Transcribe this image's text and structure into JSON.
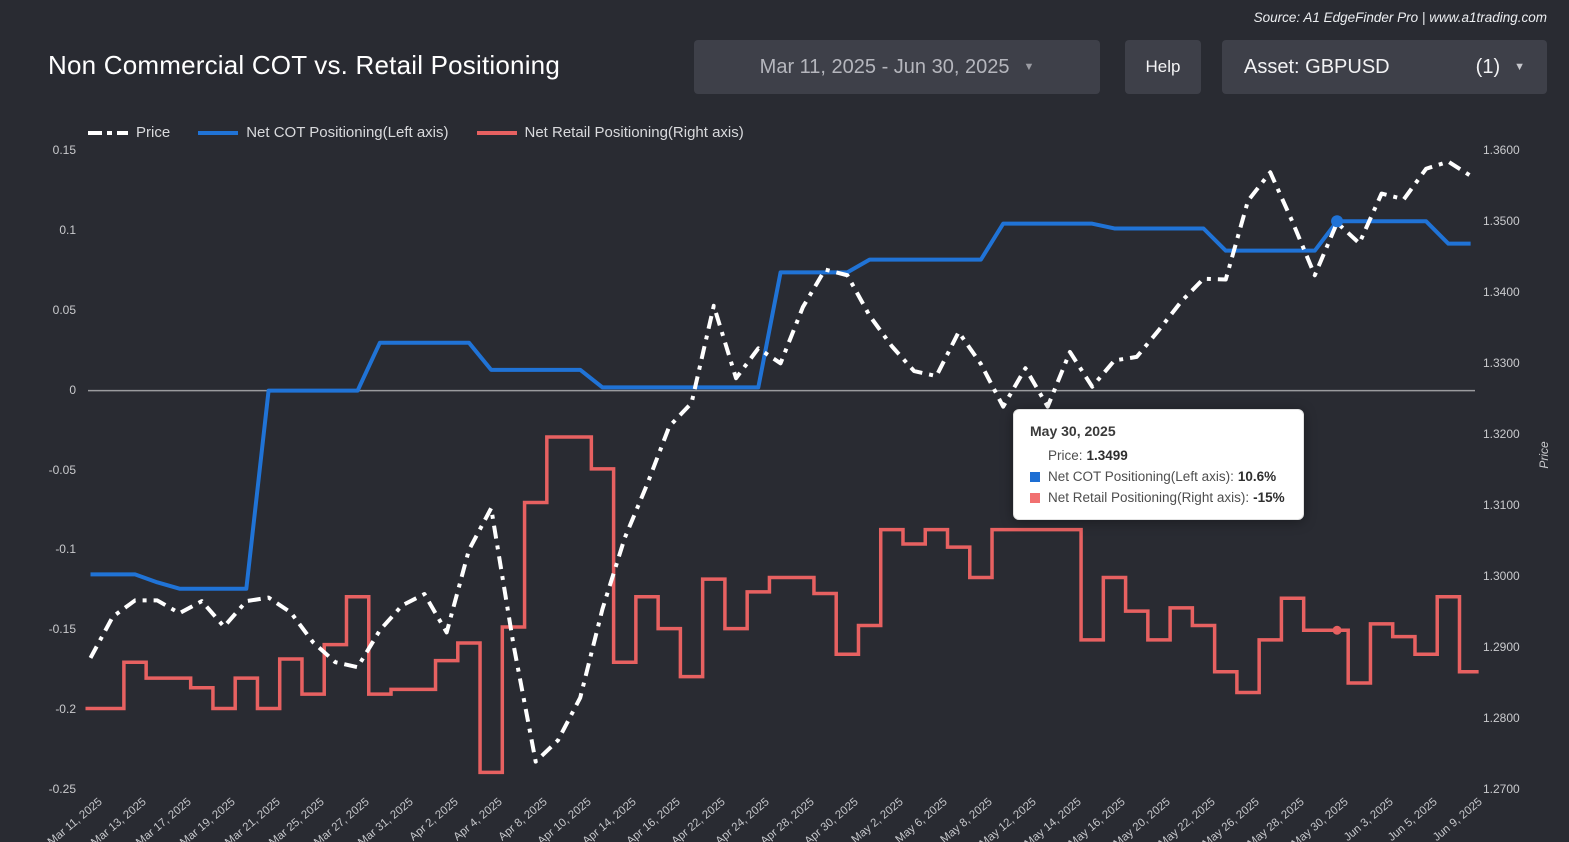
{
  "header": {
    "source_note": "Source: A1 EdgeFinder Pro | www.a1trading.com",
    "title": "Non Commercial COT vs. Retail Positioning",
    "date_range_label": "Mar 11, 2025 - Jun 30, 2025",
    "help_label": "Help",
    "asset_label": "Asset: GBPUSD",
    "asset_count": "(1)",
    "caret": "▼"
  },
  "legend": [
    {
      "name": "Price"
    },
    {
      "name": "Net COT Positioning(Left axis)"
    },
    {
      "name": "Net Retail Positioning(Right axis)"
    }
  ],
  "tooltip": {
    "title": "May 30, 2025",
    "rows": [
      {
        "label": "Price:",
        "value": "1.3499",
        "swatch": null
      },
      {
        "label": "Net COT Positioning(Left axis):",
        "value": "10.6%",
        "swatch": "#1d6ed3"
      },
      {
        "label": "Net Retail Positioning(Right axis):",
        "value": "-15%",
        "swatch": "#f17070"
      }
    ]
  },
  "chart_data": {
    "type": "line",
    "title": "Non Commercial COT vs. Retail Positioning",
    "grid": "zero-line-only",
    "legend_position": "top-left",
    "n_points": 63,
    "label_every": 2,
    "x_tick_labels": [
      "Mar 11, 2025",
      "Mar 13, 2025",
      "Mar 17, 2025",
      "Mar 19, 2025",
      "Mar 21, 2025",
      "Mar 25, 2025",
      "Mar 27, 2025",
      "Mar 31, 2025",
      "Apr 2, 2025",
      "Apr 4, 2025",
      "Apr 8, 2025",
      "Apr 10, 2025",
      "Apr 14, 2025",
      "Apr 16, 2025",
      "Apr 22, 2025",
      "Apr 24, 2025",
      "Apr 28, 2025",
      "Apr 30, 2025",
      "May 2, 2025",
      "May 6, 2025",
      "May 8, 2025",
      "May 12, 2025",
      "May 14, 2025",
      "May 16, 2025",
      "May 20, 2025",
      "May 22, 2025",
      "May 26, 2025",
      "May 28, 2025",
      "May 30, 2025",
      "Jun 3, 2025",
      "Jun 5, 2025",
      "Jun 9, 2025"
    ],
    "left_axis": {
      "tick_labels": [
        "0.15",
        "0.1",
        "0.05",
        "0",
        "-0.05",
        "-0.1",
        "-0.15",
        "-0.2",
        "-0.25"
      ],
      "range": [
        -0.25,
        0.15
      ]
    },
    "right_axis": {
      "title": "Price",
      "tick_labels": [
        "1.3600",
        "1.3500",
        "1.3400",
        "1.3300",
        "1.3200",
        "1.3100",
        "1.3000",
        "1.2900",
        "1.2800",
        "1.2700"
      ],
      "range": [
        1.27,
        1.36
      ]
    },
    "series": [
      {
        "name": "Price",
        "axis": "right",
        "style": "dashed",
        "color": "#ffffff",
        "values": [
          1.2886,
          1.2944,
          1.2967,
          1.2967,
          1.2949,
          1.2966,
          1.293,
          1.2966,
          1.2971,
          1.295,
          1.2908,
          1.288,
          1.2873,
          1.2925,
          1.296,
          1.2976,
          1.2922,
          1.3038,
          1.3097,
          1.2905,
          1.274,
          1.277,
          1.283,
          1.2955,
          1.3055,
          1.313,
          1.3212,
          1.3245,
          1.3382,
          1.328,
          1.3322,
          1.3301,
          1.338,
          1.3433,
          1.3425,
          1.3368,
          1.3325,
          1.329,
          1.3283,
          1.3345,
          1.33,
          1.324,
          1.3294,
          1.324,
          1.3317,
          1.3268,
          1.3305,
          1.331,
          1.3348,
          1.3388,
          1.342,
          1.3419,
          1.353,
          1.357,
          1.35,
          1.3425,
          1.3499,
          1.347,
          1.354,
          1.3532,
          1.3575,
          1.3585,
          1.3565
        ]
      },
      {
        "name": "Net COT Positioning(Left axis)",
        "axis": "left",
        "style": "solid",
        "color": "#2073d6",
        "values": [
          -0.115,
          -0.115,
          -0.115,
          -0.12,
          -0.124,
          -0.124,
          -0.124,
          -0.124,
          0,
          0,
          0,
          0,
          0,
          0.03,
          0.03,
          0.03,
          0.03,
          0.03,
          0.013,
          0.013,
          0.013,
          0.013,
          0.013,
          0.002,
          0.002,
          0.002,
          0.002,
          0.002,
          0.002,
          0.002,
          0.002,
          0.074,
          0.074,
          0.074,
          0.074,
          0.082,
          0.082,
          0.082,
          0.082,
          0.082,
          0.082,
          0.1045,
          0.1045,
          0.1045,
          0.1045,
          0.1045,
          0.1015,
          0.1015,
          0.1015,
          0.1015,
          0.1015,
          0.0876,
          0.0876,
          0.0876,
          0.0876,
          0.0876,
          0.106,
          0.106,
          0.106,
          0.106,
          0.106,
          0.092,
          0.092
        ]
      },
      {
        "name": "Net Retail Positioning(Right axis)",
        "axis": "left",
        "style": "step",
        "color": "#e76161",
        "values": [
          -0.199,
          -0.199,
          -0.17,
          -0.18,
          -0.18,
          -0.186,
          -0.199,
          -0.18,
          -0.199,
          -0.168,
          -0.19,
          -0.159,
          -0.129,
          -0.19,
          -0.187,
          -0.187,
          -0.169,
          -0.158,
          -0.239,
          -0.148,
          -0.07,
          -0.029,
          -0.029,
          -0.049,
          -0.17,
          -0.129,
          -0.149,
          -0.179,
          -0.118,
          -0.149,
          -0.126,
          -0.117,
          -0.117,
          -0.127,
          -0.165,
          -0.147,
          -0.087,
          -0.096,
          -0.087,
          -0.098,
          -0.117,
          -0.087,
          -0.087,
          -0.087,
          -0.087,
          -0.156,
          -0.117,
          -0.138,
          -0.156,
          -0.136,
          -0.147,
          -0.176,
          -0.189,
          -0.156,
          -0.13,
          -0.15,
          -0.15,
          -0.183,
          -0.146,
          -0.154,
          -0.165,
          -0.129,
          -0.176
        ]
      }
    ],
    "highlight": {
      "index": 56,
      "label": "May 30, 2025",
      "price": 1.3499,
      "cot": 0.106,
      "retail": -0.15
    }
  }
}
